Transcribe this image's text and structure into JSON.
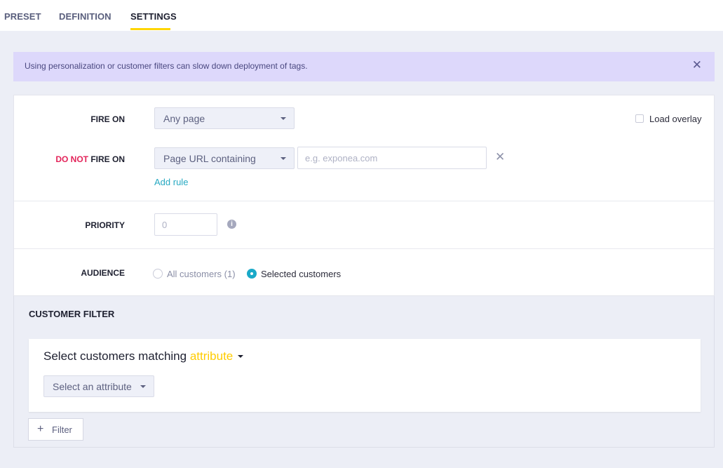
{
  "tabs": [
    {
      "label": "PRESET",
      "active": false
    },
    {
      "label": "DEFINITION",
      "active": false
    },
    {
      "label": "SETTINGS",
      "active": true
    }
  ],
  "alert": {
    "text": "Using personalization or customer filters can slow down deployment of tags.",
    "close_icon": "close-icon"
  },
  "fire_on": {
    "label": "FIRE ON",
    "value": "Any page"
  },
  "load_overlay": {
    "label": "Load overlay",
    "checked": false
  },
  "do_not_fire_on": {
    "label_prefix": "DO NOT",
    "label_suffix": "FIRE ON",
    "condition": "Page URL containing",
    "value": "",
    "placeholder": "e.g. exponea.com",
    "add_rule": "Add rule"
  },
  "priority": {
    "label": "PRIORITY",
    "value": "",
    "placeholder": "0"
  },
  "audience": {
    "label": "AUDIENCE",
    "options": [
      {
        "label": "All customers (1)",
        "selected": false
      },
      {
        "label": "Selected customers",
        "selected": true
      }
    ]
  },
  "customer_filter": {
    "title": "CUSTOMER FILTER",
    "match_prefix": "Select customers matching",
    "match_mode": "attribute",
    "attribute_select": "Select an attribute",
    "add_filter": "Filter"
  },
  "colors": {
    "accent_yellow": "#ffd500",
    "link_teal": "#27a9c2",
    "danger_red": "#e3245a",
    "alert_bg": "#ddd8fb"
  }
}
